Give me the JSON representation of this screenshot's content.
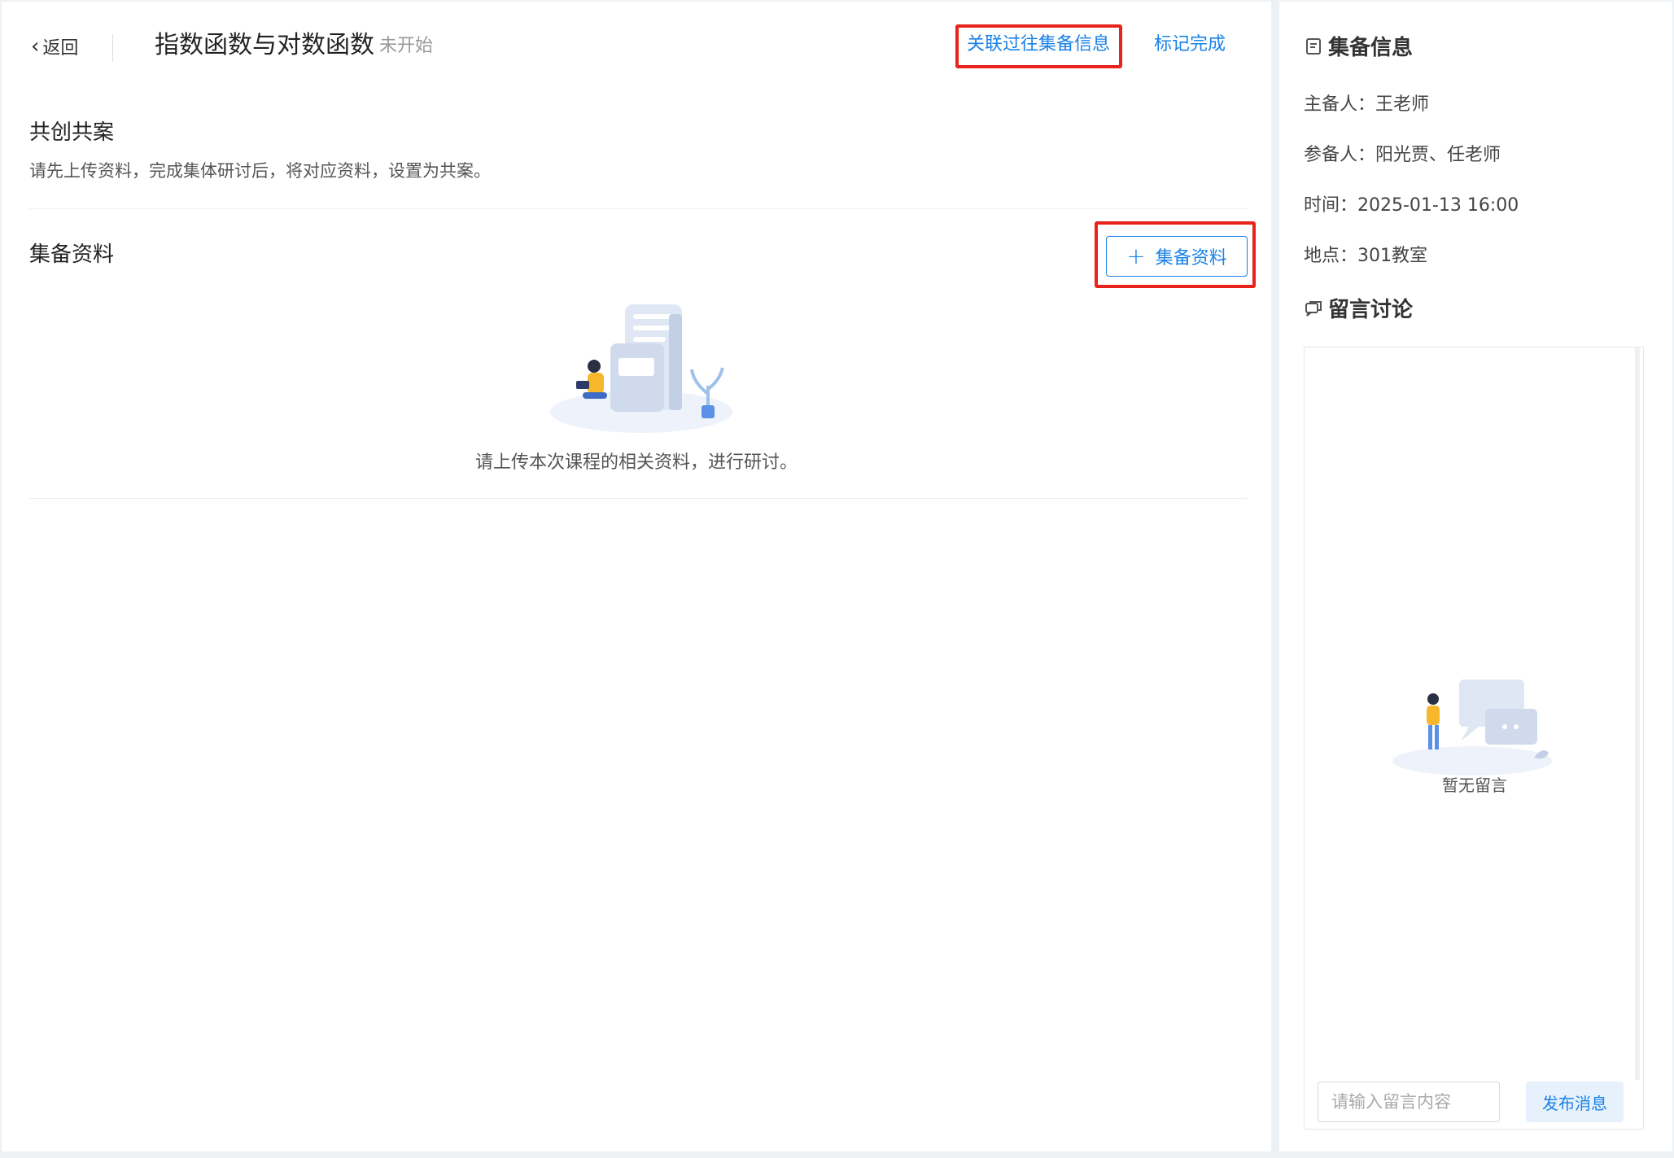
{
  "header": {
    "back_label": "返回",
    "title": "指数函数与对数函数",
    "status": "未开始",
    "link_past_label": "关联过往集备信息",
    "mark_done_label": "标记完成"
  },
  "shared_plan": {
    "title": "共创共案",
    "description": "请先上传资料，完成集体研讨后，将对应资料，设置为共案。"
  },
  "materials": {
    "title": "集备资料",
    "add_label": "集备资料",
    "empty_text": "请上传本次课程的相关资料，进行研讨。"
  },
  "side": {
    "info_title": "集备信息",
    "host": "主备人：王老师",
    "participants": "参备人：阳光贾、任老师",
    "time": "时间：2025-01-13 16:00",
    "place": "地点：301教室",
    "discussion_title": "留言讨论",
    "empty_msg": "暂无留言",
    "input_placeholder": "请输入留言内容",
    "send_label": "发布消息"
  },
  "colors": {
    "accent": "#1a82e6",
    "highlight": "#e8231c"
  }
}
